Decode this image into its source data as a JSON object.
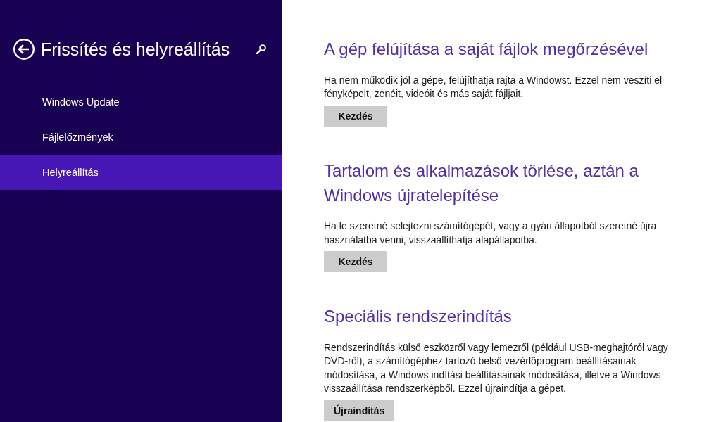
{
  "header": {
    "title": "Frissítés és helyreállítás"
  },
  "nav": {
    "items": [
      {
        "label": "Windows Update",
        "selected": false
      },
      {
        "label": "Fájlelőzmények",
        "selected": false
      },
      {
        "label": "Helyreállítás",
        "selected": true
      }
    ]
  },
  "sections": [
    {
      "heading": "A gép felújítása a saját fájlok megőrzésével",
      "description": "Ha nem működik jól a gépe, felújíthatja rajta a Windowst. Ezzel nem veszíti el fényképeit, zenéit, videóit és más saját fájljait.",
      "button": "Kezdés"
    },
    {
      "heading": "Tartalom és alkalmazások törlése, aztán a Windows újratelepítése",
      "description": "Ha le szeretné selejtezni számítógépét, vagy a gyári állapotból szeretné újra használatba venni, visszaállíthatja alapállapotba.",
      "button": "Kezdés"
    },
    {
      "heading": "Speciális rendszerindítás",
      "description": "Rendszerindítás külső eszközről vagy lemezről (például USB-meghajtóról vagy DVD-ről), a számítógéphez tartozó belső vezérlőprogram beállításainak módosítása, a Windows indítási beállításainak módosítása, illetve a Windows visszaállítása rendszerképből. Ezzel újraindítja a gépet.",
      "button": "Újraindítás"
    }
  ]
}
